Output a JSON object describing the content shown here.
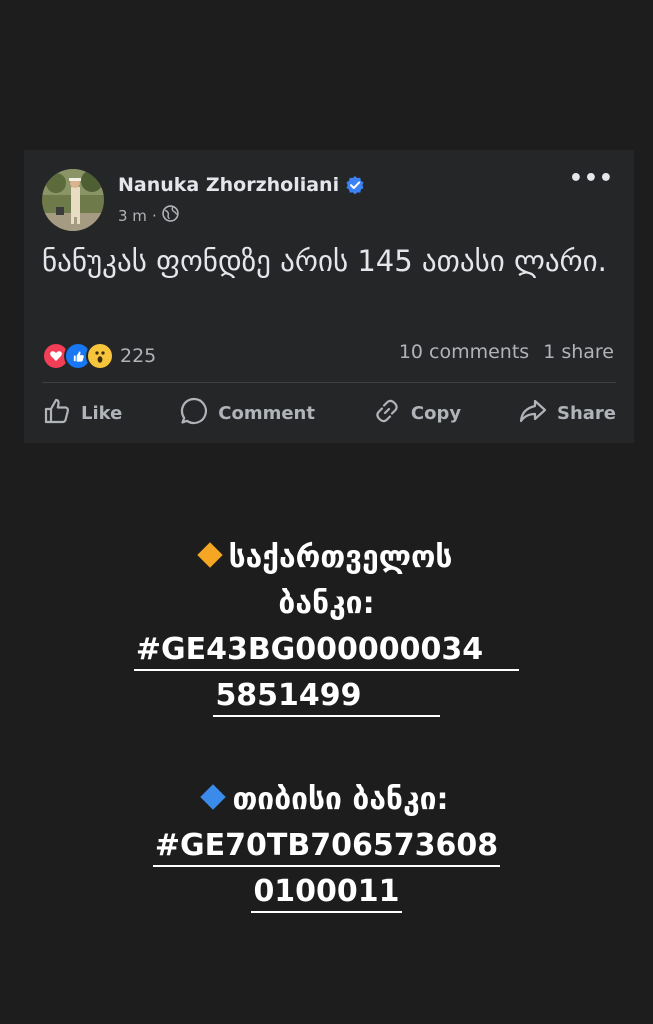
{
  "post": {
    "author": "Nanuka Zhorzholiani",
    "time": "3 m",
    "body": "ნანუკას ფონდზე არის 145 ათასი ლარი.",
    "reaction_count": "225",
    "comments": "10 comments",
    "shares": "1 share",
    "actions": {
      "like": "Like",
      "comment": "Comment",
      "copy": "Copy",
      "share": "Share"
    },
    "verified_color": "#3b82f6"
  },
  "banks": [
    {
      "icon": "orange-diamond-icon",
      "name_line1": "საქართველოს",
      "name_line2": "ბანკი:",
      "iban_line1": "#GE43BG000000034",
      "iban_line2": "5851499"
    },
    {
      "icon": "blue-diamond-icon",
      "name_line1": "თიბისი ბანკი:",
      "iban_line1": "#GE70TB706573608",
      "iban_line2": "0100011"
    }
  ],
  "colors": {
    "background": "#1d1d1d",
    "card": "#252628",
    "orange_diamond": "#f5a623",
    "blue_diamond": "#3b8beb"
  }
}
